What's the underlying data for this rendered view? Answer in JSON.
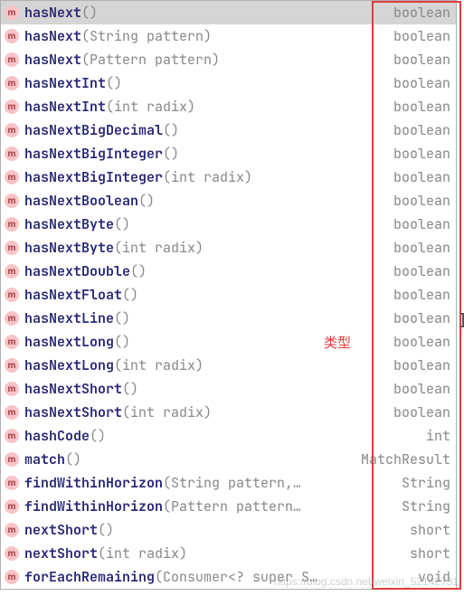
{
  "annotation_label": "类型",
  "watermark": "https://blog.csdn.net/weixin_52142731",
  "highlight_letter": "h",
  "entries": [
    {
      "name": "hasNext",
      "params": "()",
      "ret": "boolean",
      "selected": true
    },
    {
      "name": "hasNext",
      "params": "(String pattern)",
      "ret": "boolean",
      "selected": false
    },
    {
      "name": "hasNext",
      "params": "(Pattern pattern)",
      "ret": "boolean",
      "selected": false
    },
    {
      "name": "hasNextInt",
      "params": "()",
      "ret": "boolean",
      "selected": false
    },
    {
      "name": "hasNextInt",
      "params": "(int radix)",
      "ret": "boolean",
      "selected": false
    },
    {
      "name": "hasNextBigDecimal",
      "params": "()",
      "ret": "boolean",
      "selected": false
    },
    {
      "name": "hasNextBigInteger",
      "params": "()",
      "ret": "boolean",
      "selected": false
    },
    {
      "name": "hasNextBigInteger",
      "params": "(int radix)",
      "ret": "boolean",
      "selected": false
    },
    {
      "name": "hasNextBoolean",
      "params": "()",
      "ret": "boolean",
      "selected": false
    },
    {
      "name": "hasNextByte",
      "params": "()",
      "ret": "boolean",
      "selected": false
    },
    {
      "name": "hasNextByte",
      "params": "(int radix)",
      "ret": "boolean",
      "selected": false
    },
    {
      "name": "hasNextDouble",
      "params": "()",
      "ret": "boolean",
      "selected": false
    },
    {
      "name": "hasNextFloat",
      "params": "()",
      "ret": "boolean",
      "selected": false
    },
    {
      "name": "hasNextLine",
      "params": "()",
      "ret": "boolean",
      "selected": false
    },
    {
      "name": "hasNextLong",
      "params": "()",
      "ret": "boolean",
      "selected": false
    },
    {
      "name": "hasNextLong",
      "params": "(int radix)",
      "ret": "boolean",
      "selected": false
    },
    {
      "name": "hasNextShort",
      "params": "()",
      "ret": "boolean",
      "selected": false
    },
    {
      "name": "hasNextShort",
      "params": "(int radix)",
      "ret": "boolean",
      "selected": false
    },
    {
      "name": "hashCode",
      "params": "()",
      "ret": "int",
      "selected": false
    },
    {
      "name": "match",
      "params": "()",
      "ret": "MatchResult",
      "selected": false
    },
    {
      "name": "findWithinHorizon",
      "params": "(String pattern,…",
      "ret": "String",
      "selected": false
    },
    {
      "name": "findWithinHorizon",
      "params": "(Pattern pattern…",
      "ret": "String",
      "selected": false
    },
    {
      "name": "nextShort",
      "params": "()",
      "ret": "short",
      "selected": false
    },
    {
      "name": "nextShort",
      "params": "(int radix)",
      "ret": "short",
      "selected": false
    },
    {
      "name": "forEachRemaining",
      "params": "(Consumer<? super S…",
      "ret": "void",
      "selected": false
    }
  ]
}
